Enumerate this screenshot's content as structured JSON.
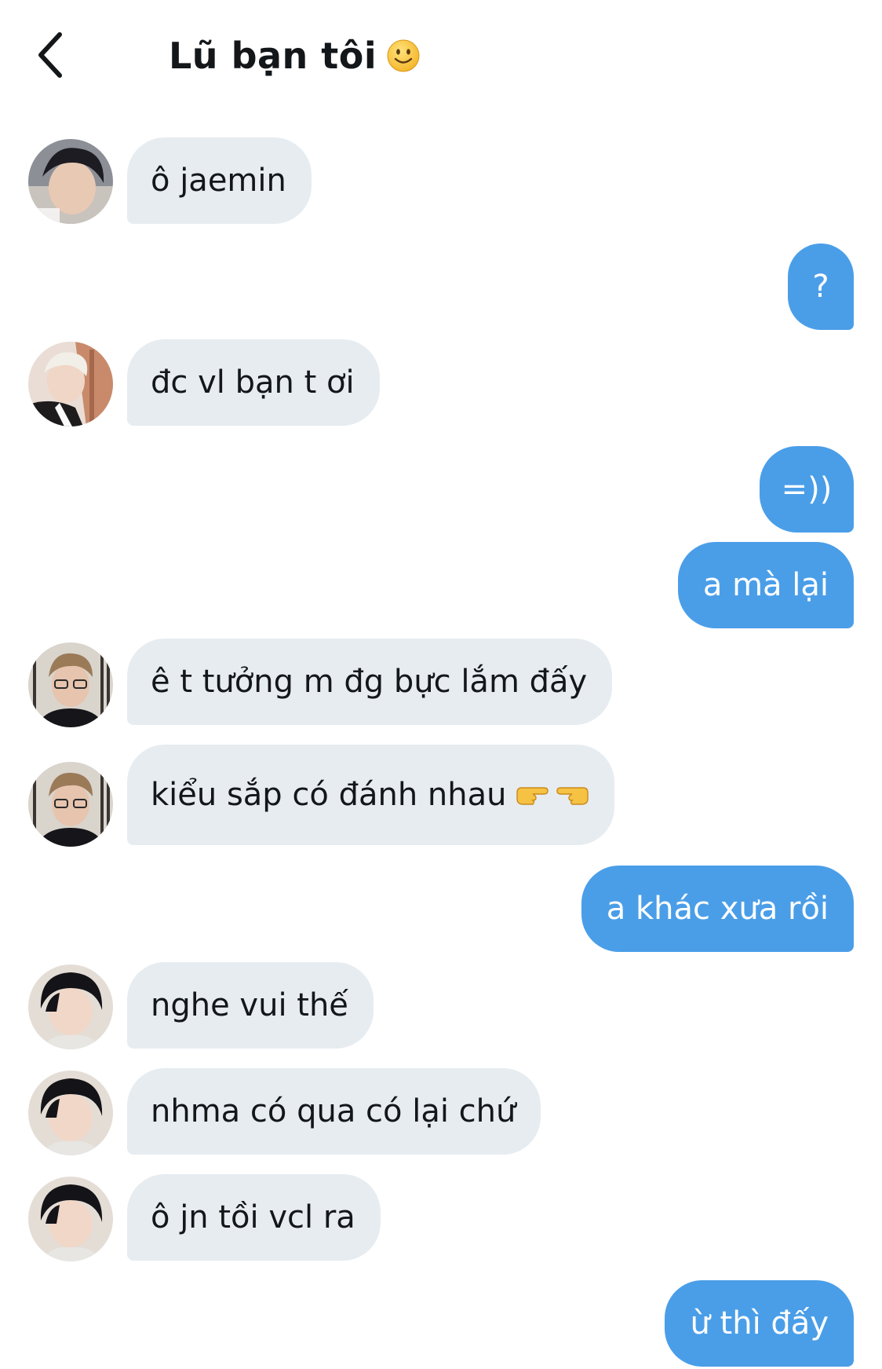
{
  "header": {
    "title": "Lũ bạn tôi",
    "title_emoji": "slightly-smiling-face-icon"
  },
  "colors": {
    "incoming_bubble": "#e6ecf0",
    "outgoing_bubble": "#4a9ee8",
    "text_dark": "#14171a",
    "text_light": "#ffffff"
  },
  "messages": [
    {
      "direction": "incoming",
      "text": "ô jaemin"
    },
    {
      "direction": "outgoing",
      "text": "?"
    },
    {
      "direction": "incoming",
      "text": "đc vl bạn t ơi"
    },
    {
      "direction": "outgoing",
      "text": "=))"
    },
    {
      "direction": "outgoing",
      "text": "a mà lại"
    },
    {
      "direction": "incoming",
      "text": "ê t tưởng m đg bực lắm đấy"
    },
    {
      "direction": "incoming",
      "text": "kiểu sắp có đánh nhau",
      "emojis": [
        "pointing-right-icon",
        "pointing-left-icon"
      ]
    },
    {
      "direction": "outgoing",
      "text": "a khác xưa rồi"
    },
    {
      "direction": "incoming",
      "text": "nghe vui thế"
    },
    {
      "direction": "incoming",
      "text": "nhma có qua có lại chứ"
    },
    {
      "direction": "incoming",
      "text": "ô jn tồi vcl ra"
    },
    {
      "direction": "outgoing",
      "text": "ừ thì đấy"
    }
  ]
}
